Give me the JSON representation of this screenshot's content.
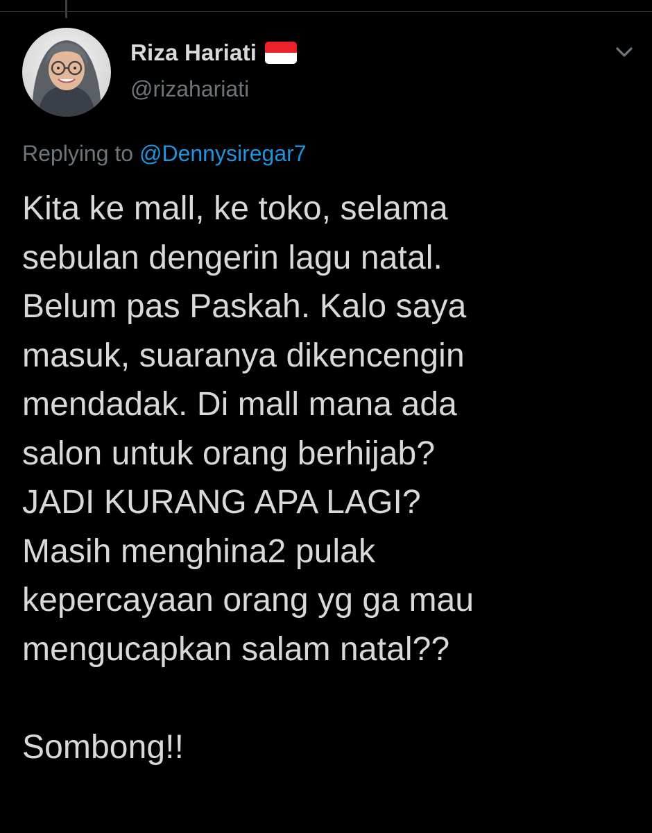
{
  "tweet": {
    "author": {
      "display_name": "Riza Hariati",
      "handle": "@rizahariati",
      "flag_icon": "indonesia-flag-icon",
      "avatar_icon": "profile-photo"
    },
    "menu_icon": "chevron-down-icon",
    "replying_to": {
      "label": "Replying to",
      "mention": "@Dennysiregar7"
    },
    "text": "Kita ke mall, ke toko, selama\nsebulan dengerin lagu natal.\nBelum pas Paskah. Kalo saya\nmasuk, suaranya dikencengin\nmendadak. Di mall mana ada\nsalon untuk orang berhijab?\nJADI KURANG APA LAGI?\nMasih menghina2 pulak\nkepercayaan orang yg ga mau\nmengucapkan salam natal??\n\nSombong!!"
  },
  "colors": {
    "background": "#000000",
    "primary_text": "#d9d9d9",
    "secondary_text": "#6e767d",
    "link": "#1b95e0",
    "flag_red": "#e8212b",
    "flag_white": "#ffffff"
  }
}
